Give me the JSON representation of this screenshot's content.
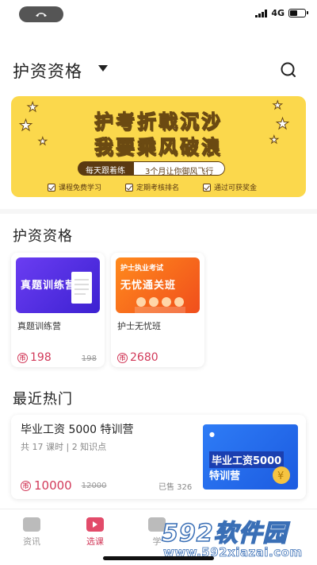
{
  "status_bar": {
    "network": "4G"
  },
  "header": {
    "title": "护资资格"
  },
  "banner": {
    "line1": "护考折戟沉沙",
    "line2": "我要乘风破浪",
    "pill_left": "每天跟着练",
    "pill_right": "3个月让你御风飞行",
    "perks": [
      "课程免费学习",
      "定期考核排名",
      "通过可获奖金"
    ]
  },
  "section_qualification": {
    "title": "护资资格"
  },
  "courses": [
    {
      "thumb_title": "真题训练营",
      "thumb_tag": "",
      "name": "真题训练营",
      "price": "198",
      "original_price": "198"
    },
    {
      "thumb_title": "无忧通关班",
      "thumb_tag": "护士执业考试",
      "name": "护士无忧班",
      "price": "2680",
      "original_price": ""
    }
  ],
  "section_hot": {
    "title": "最近热门"
  },
  "hot_course": {
    "title": "毕业工资 5000 特训营",
    "meta": "共 17 课时 | 2 知识点",
    "price": "10000",
    "original_price": "12000",
    "sold": "已售 326",
    "thumb_line1": "毕业工资5000",
    "thumb_line2": "特训营"
  },
  "bottom_nav": {
    "items": [
      {
        "label": "资讯",
        "icon": "news-icon"
      },
      {
        "label": "选课",
        "icon": "course-play-icon"
      },
      {
        "label": "学",
        "icon": "study-icon"
      }
    ]
  },
  "watermark": {
    "logo": "592软件园",
    "url": "www.592xiazai.com"
  },
  "colors": {
    "accent": "#d23a5a",
    "banner_bg": "#fbd84c"
  }
}
